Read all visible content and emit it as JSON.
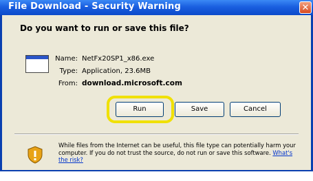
{
  "window": {
    "title": "File Download - Security Warning",
    "close_label": "✕"
  },
  "prompt": {
    "question": "Do you want to run or save this file?"
  },
  "file": {
    "icon": "application-window-icon",
    "name_label": "Name:",
    "name_value": "NetFx20SP1_x86.exe",
    "type_label": "Type:",
    "type_value": "Application, 23.6MB",
    "from_label": "From:",
    "from_value": "download.microsoft.com"
  },
  "buttons": {
    "run": "Run",
    "save": "Save",
    "cancel": "Cancel"
  },
  "highlight_color": "#f0e000",
  "warning": {
    "icon": "security-shield-icon",
    "text": "While files from the Internet can be useful, this file type can potentially harm your computer. If you do not trust the source, do not run or save this software.",
    "link": "What's the risk?"
  }
}
